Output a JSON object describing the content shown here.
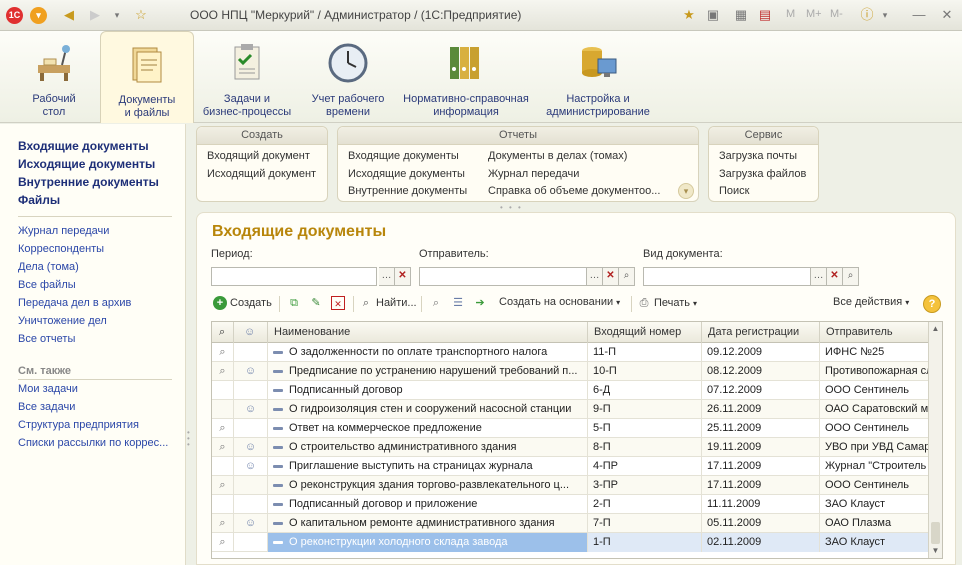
{
  "window": {
    "title": "ООО НПЦ \"Меркурий\" / Администратор /  (1С:Предприятие)",
    "logo_text": "1С",
    "memory_buttons": [
      "M",
      "M+",
      "M-"
    ]
  },
  "sections": [
    {
      "label": "Рабочий\nстол",
      "icon": "desk-icon"
    },
    {
      "label": "Документы\nи файлы",
      "icon": "documents-icon",
      "active": true
    },
    {
      "label": "Задачи и\nбизнес-процессы",
      "icon": "tasks-icon"
    },
    {
      "label": "Учет рабочего\nвремени",
      "icon": "clock-icon"
    },
    {
      "label": "Нормативно-справочная\nинформация",
      "icon": "binders-icon"
    },
    {
      "label": "Настройка и\nадминистрирование",
      "icon": "admin-icon"
    }
  ],
  "leftnav": {
    "main_items": [
      "Входящие документы",
      "Исходящие документы",
      "Внутренние документы",
      "Файлы"
    ],
    "links": [
      "Журнал передачи",
      "Корреспонденты",
      "Дела (тома)",
      "Все файлы",
      "Передача дел в архив",
      "Уничтожение дел",
      "Все отчеты"
    ],
    "see_also_title": "См. также",
    "see_also": [
      "Мои задачи",
      "Все задачи",
      "Структура предприятия",
      "Списки рассылки по коррес..."
    ]
  },
  "command_groups": {
    "create": {
      "title": "Создать",
      "items": [
        "Входящий документ",
        "Исходящий документ"
      ]
    },
    "reports": {
      "title": "Отчеты",
      "col1": [
        "Входящие документы",
        "Исходящие документы",
        "Внутренние документы"
      ],
      "col2": [
        "Документы в делах (томах)",
        "Журнал передачи",
        "Справка об объеме документоо..."
      ]
    },
    "service": {
      "title": "Сервис",
      "items": [
        "Загрузка почты",
        "Загрузка файлов",
        "Поиск"
      ]
    }
  },
  "form": {
    "title": "Входящие документы",
    "period_label": "Период:",
    "period_value": "",
    "sender_label": "Отправитель:",
    "sender_value": "",
    "doctype_label": "Вид документа:",
    "doctype_value": ""
  },
  "toolbar": {
    "create": "Создать",
    "find": "Найти...",
    "create_based_on": "Создать на основании",
    "print": "Печать",
    "all_actions": "Все действия"
  },
  "table": {
    "columns": [
      "Наименование",
      "Входящий номер",
      "Дата регистрации",
      "Отправитель"
    ],
    "rows": [
      {
        "clip": true,
        "people": false,
        "name": "О задолженности по оплате транспортного налога",
        "num": "11-П",
        "date": "09.12.2009",
        "sender": "ИФНС №25"
      },
      {
        "clip": true,
        "people": true,
        "name": "Предписание по устранению нарушений требований п...",
        "num": "10-П",
        "date": "08.12.2009",
        "sender": "Противопожарная сл"
      },
      {
        "clip": false,
        "people": false,
        "name": "Подписанный договор",
        "num": "6-Д",
        "date": "07.12.2009",
        "sender": "ООО Сентинель"
      },
      {
        "clip": false,
        "people": true,
        "name": "О гидроизоляция стен и сооружений насосной станции",
        "num": "9-П",
        "date": "26.11.2009",
        "sender": "ОАО Саратовский м"
      },
      {
        "clip": true,
        "people": false,
        "name": "Ответ на коммерческое предложение",
        "num": "5-П",
        "date": "25.11.2009",
        "sender": "ООО Сентинель"
      },
      {
        "clip": true,
        "people": true,
        "name": "О строительство административного здания",
        "num": "8-П",
        "date": "19.11.2009",
        "sender": "УВО при УВД Самар"
      },
      {
        "clip": false,
        "people": true,
        "name": "Приглашение выступить на страницах журнала",
        "num": "4-ПР",
        "date": "17.11.2009",
        "sender": "Журнал \"Строитель"
      },
      {
        "clip": true,
        "people": false,
        "name": "О реконструкция здания торгово-развлекательного ц...",
        "num": "3-ПР",
        "date": "17.11.2009",
        "sender": "ООО Сентинель"
      },
      {
        "clip": false,
        "people": false,
        "name": "Подписанный договор и приложение",
        "num": "2-П",
        "date": "11.11.2009",
        "sender": "ЗАО Клауст"
      },
      {
        "clip": true,
        "people": true,
        "name": "О капитальном ремонте административного здания",
        "num": "7-П",
        "date": "05.11.2009",
        "sender": "ОАО Плазма"
      },
      {
        "clip": true,
        "people": false,
        "name": "О реконструкции холодного склада завода",
        "num": "1-П",
        "date": "02.11.2009",
        "sender": "ЗАО Клауст",
        "selected": true
      }
    ]
  }
}
